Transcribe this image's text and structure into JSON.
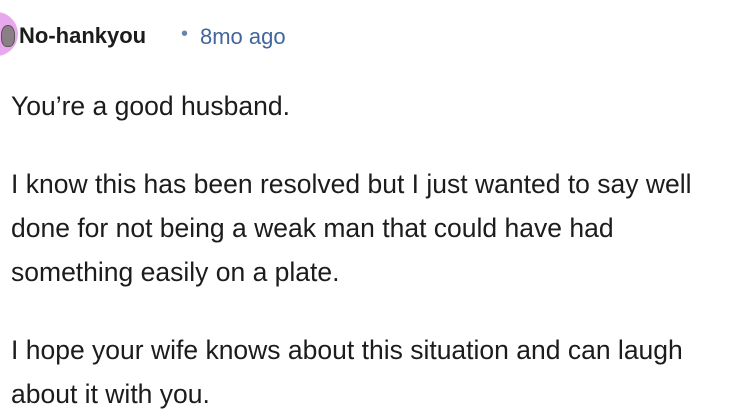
{
  "comment": {
    "author": "No-hankyou",
    "separator": "•",
    "timestamp": "8mo ago",
    "paragraphs": [
      "You’re a good husband.",
      "I know this has been resolved but I just wanted to say well done for not being a weak man that could have had something easily on a plate.",
      "I hope your wife knows about this situation and can laugh about it with you."
    ],
    "avatar_color": "#e7a8ec",
    "timestamp_color": "#41659c"
  }
}
